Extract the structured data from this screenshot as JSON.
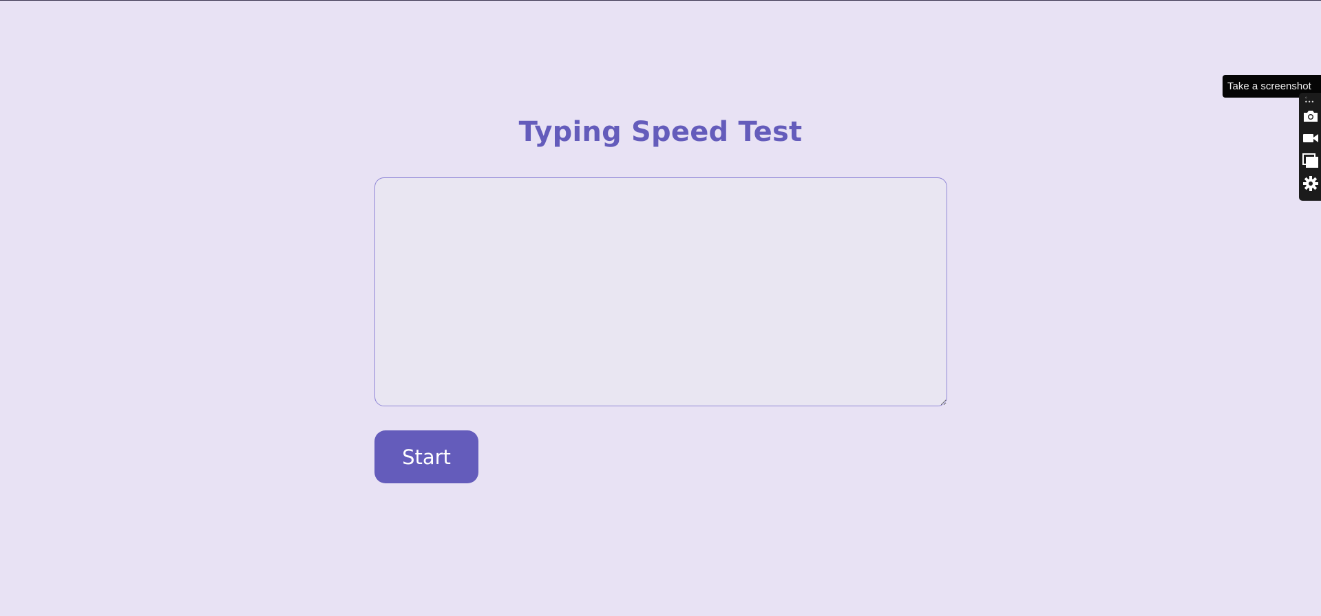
{
  "page": {
    "title": "Typing Speed Test"
  },
  "typing_area": {
    "value": "",
    "placeholder": ""
  },
  "controls": {
    "start_label": "Start"
  },
  "screenshot_widget": {
    "tooltip": "Take a screenshot",
    "tools": [
      "camera-icon",
      "video-icon",
      "window-icon",
      "gear-icon"
    ]
  },
  "colors": {
    "background": "#e8e2f4",
    "accent": "#645cbb",
    "button_text": "#ffffff"
  }
}
